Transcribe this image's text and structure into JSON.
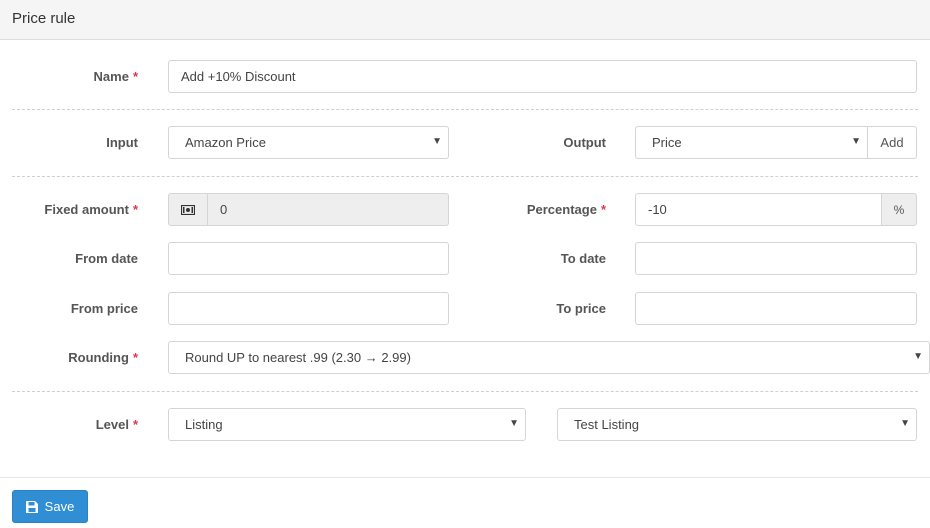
{
  "header": {
    "title": "Price rule"
  },
  "form": {
    "name": {
      "label": "Name",
      "required_mark": "*",
      "value": "Add +10% Discount"
    },
    "input": {
      "label": "Input",
      "selected": "Amazon Price"
    },
    "output": {
      "label": "Output",
      "selected": "Price",
      "add_label": "Add"
    },
    "fixed_amount": {
      "label": "Fixed amount",
      "required_mark": "*",
      "value": "0",
      "icon": "money-icon"
    },
    "percentage": {
      "label": "Percentage",
      "required_mark": "*",
      "value": "-10",
      "addon": "%"
    },
    "from_date": {
      "label": "From date",
      "value": ""
    },
    "to_date": {
      "label": "To date",
      "value": ""
    },
    "from_price": {
      "label": "From price",
      "value": ""
    },
    "to_price": {
      "label": "To price",
      "value": ""
    },
    "rounding": {
      "label": "Rounding",
      "required_mark": "*",
      "selected": "Round UP to nearest .99 (2.30 → 2.99)"
    },
    "level": {
      "label": "Level",
      "required_mark": "*",
      "selected": "Listing",
      "target_selected": "Test Listing"
    }
  },
  "footer": {
    "save_label": "Save"
  },
  "colors": {
    "primary": "#2f8ed4",
    "required": "#e0354b"
  }
}
